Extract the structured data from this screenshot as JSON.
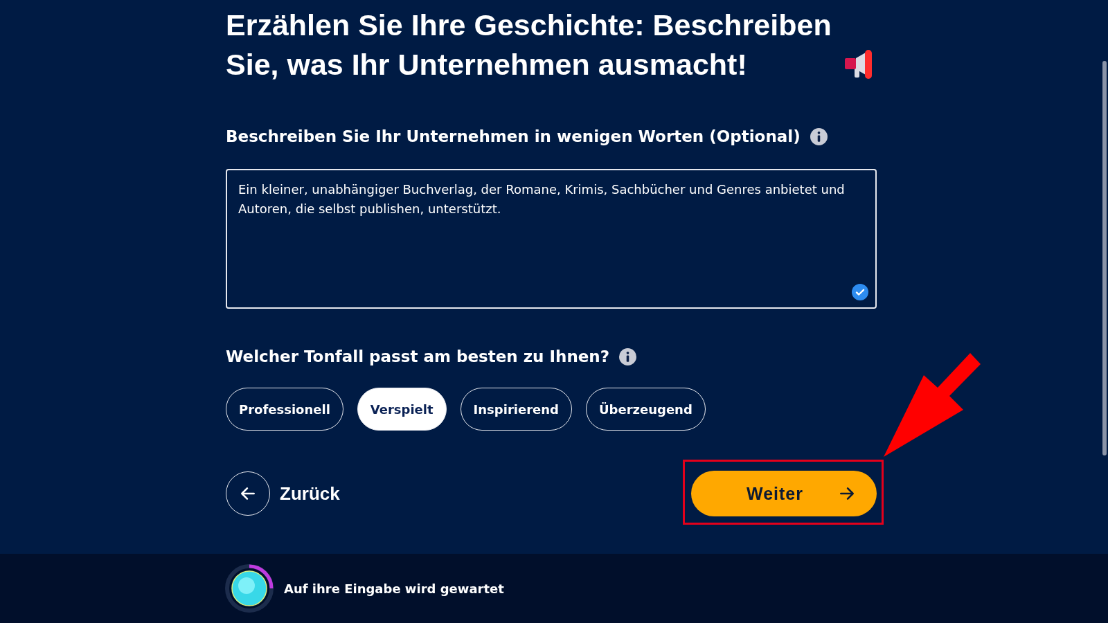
{
  "heading": "Erzählen Sie Ihre Geschichte: Beschreiben Sie, was Ihr Unternehmen ausmacht!",
  "description": {
    "label": "Beschreiben Sie Ihr Unternehmen in wenigen Worten (Optional)",
    "value": "Ein kleiner, unabhängiger Buchverlag, der Romane, Krimis, Sachbücher und Genres anbietet und Autoren, die selbst publishen, unterstützt.",
    "valid": true
  },
  "tone": {
    "label": "Welcher Tonfall passt am besten zu Ihnen?",
    "options": [
      {
        "label": "Professionell",
        "selected": false
      },
      {
        "label": "Verspielt",
        "selected": true
      },
      {
        "label": "Inspirierend",
        "selected": false
      },
      {
        "label": "Überzeugend",
        "selected": false
      }
    ]
  },
  "back_button": "Zurück",
  "next_button": "Weiter",
  "status": "Auf ihre Eingabe wird gewartet"
}
